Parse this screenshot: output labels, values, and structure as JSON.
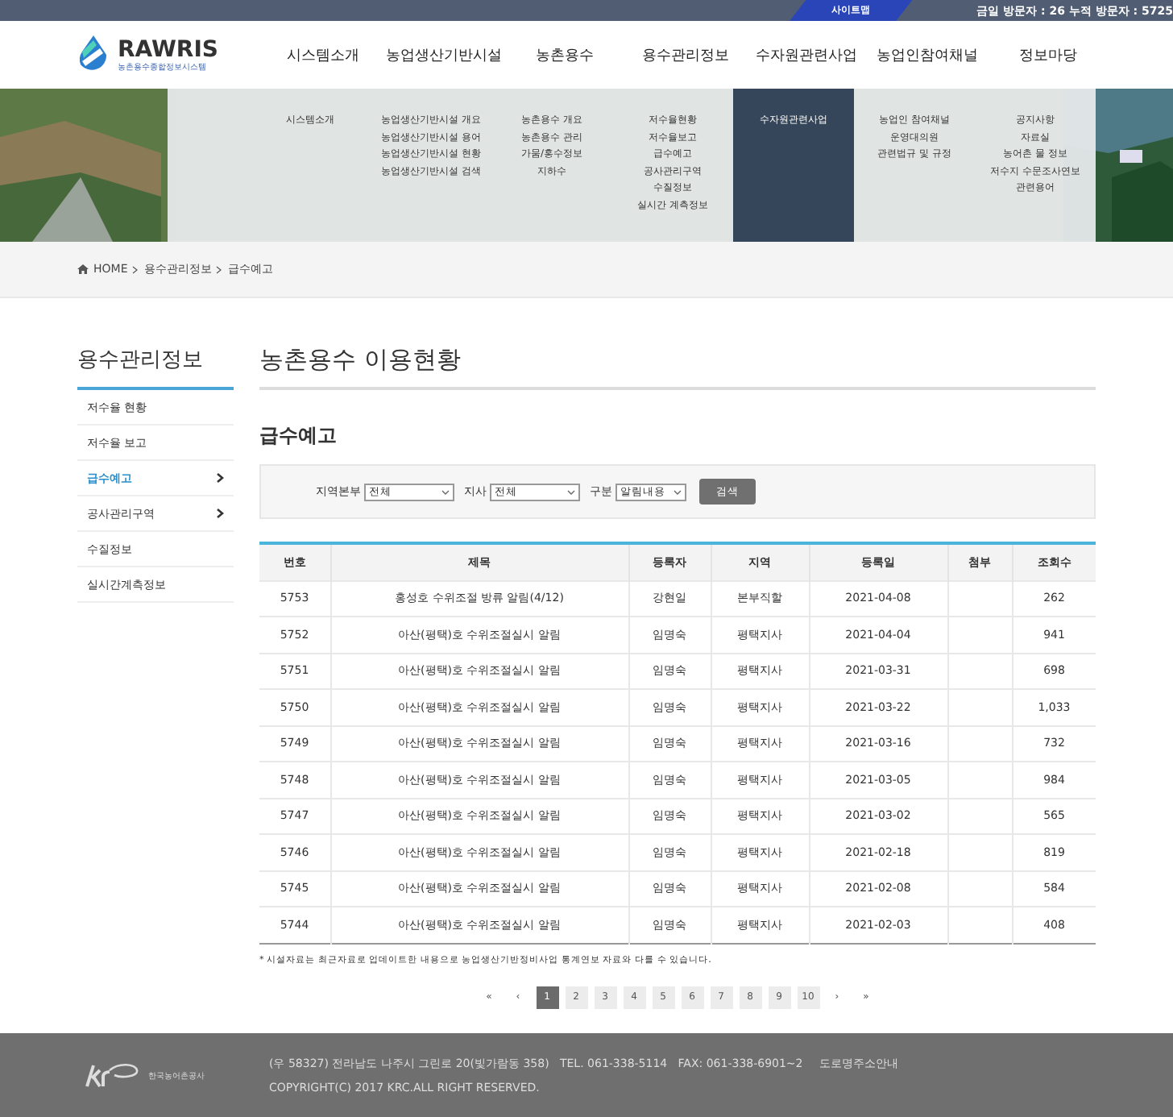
{
  "top_bar": {
    "sitemap": "사이트맵",
    "visitors": "금일 방문자 : 26 누적 방문자 : 5725"
  },
  "logo": {
    "name": "RAWRIS",
    "subtitle": "농촌용수종합정보시스템"
  },
  "nav": [
    {
      "label": "시스템소개",
      "selected": false,
      "children": [
        "시스템소개"
      ]
    },
    {
      "label": "농업생산기반시설",
      "selected": false,
      "children": [
        "농업생산기반시설 개요",
        "농업생산기반시설 용어",
        "농업생산기반시설 현황",
        "농업생산기반시설 검색"
      ]
    },
    {
      "label": "농촌용수",
      "selected": false,
      "children": [
        "농촌용수 개요",
        "농촌용수 관리",
        "가뭄/홍수정보",
        "지하수"
      ]
    },
    {
      "label": "용수관리정보",
      "selected": false,
      "children": [
        "저수율현황",
        "저수율보고",
        "급수예고",
        "공사관리구역",
        "수질정보",
        "실시간 계측정보"
      ]
    },
    {
      "label": "수자원관련사업",
      "selected": true,
      "children": [
        "수자원관련사업"
      ]
    },
    {
      "label": "농업인참여채널",
      "selected": false,
      "children": [
        "농업인 참여채널",
        "운영대의원",
        "관련법규 및 규정"
      ]
    },
    {
      "label": "정보마당",
      "selected": false,
      "children": [
        "공지사항",
        "자료실",
        "농어촌 물 정보",
        "저수지 수문조사연보",
        "관련용어"
      ]
    }
  ],
  "breadcrumb": [
    "HOME",
    "용수관리정보",
    "급수예고"
  ],
  "sidebar": {
    "title": "용수관리정보",
    "items": [
      {
        "label": "저수율 현황",
        "selected": false,
        "arrow": false
      },
      {
        "label": "저수율 보고",
        "selected": false,
        "arrow": false
      },
      {
        "label": "급수예고",
        "selected": true,
        "arrow": true
      },
      {
        "label": "공사관리구역",
        "selected": false,
        "arrow": true
      },
      {
        "label": "수질정보",
        "selected": false,
        "arrow": false
      },
      {
        "label": "실시간계측정보",
        "selected": false,
        "arrow": false
      }
    ]
  },
  "page_title": "농촌용수 이용현황",
  "section_title": "급수예고",
  "filters": [
    {
      "label": "지역본부",
      "value": "전체"
    },
    {
      "label": "지사",
      "value": "전체"
    },
    {
      "label": "구분",
      "value": "알림내용"
    }
  ],
  "search_button": "검색",
  "table": {
    "columns": [
      "번호",
      "제목",
      "등록자",
      "지역",
      "등록일",
      "첨부",
      "조회수"
    ],
    "rows": [
      [
        "5753",
        "홍성호 수위조절 방류 알림(4/12)",
        "강현일",
        "본부직할",
        "2021-04-08",
        "",
        "262"
      ],
      [
        "5752",
        "아산(평택)호 수위조절실시 알림",
        "임명숙",
        "평택지사",
        "2021-04-04",
        "",
        "941"
      ],
      [
        "5751",
        "아산(평택)호 수위조절실시 알림",
        "임명숙",
        "평택지사",
        "2021-03-31",
        "",
        "698"
      ],
      [
        "5750",
        "아산(평택)호 수위조절실시 알림",
        "임명숙",
        "평택지사",
        "2021-03-22",
        "",
        "1,033"
      ],
      [
        "5749",
        "아산(평택)호 수위조절실시 알림",
        "임명숙",
        "평택지사",
        "2021-03-16",
        "",
        "732"
      ],
      [
        "5748",
        "아산(평택)호 수위조절실시 알림",
        "임명숙",
        "평택지사",
        "2021-03-05",
        "",
        "984"
      ],
      [
        "5747",
        "아산(평택)호 수위조절실시 알림",
        "임명숙",
        "평택지사",
        "2021-03-02",
        "",
        "565"
      ],
      [
        "5746",
        "아산(평택)호 수위조절실시 알림",
        "임명숙",
        "평택지사",
        "2021-02-18",
        "",
        "819"
      ],
      [
        "5745",
        "아산(평택)호 수위조절실시 알림",
        "임명숙",
        "평택지사",
        "2021-02-08",
        "",
        "584"
      ],
      [
        "5744",
        "아산(평택)호 수위조절실시 알림",
        "임명숙",
        "평택지사",
        "2021-02-03",
        "",
        "408"
      ]
    ]
  },
  "note": "* 시설자료는 최근자료로 업데이트한 내용으로 농업생산기반정비사업 통계연보 자료와 다를 수 있습니다.",
  "pagination": {
    "first": "«",
    "prev": "‹",
    "pages": [
      {
        "label": "1",
        "selected": true
      },
      {
        "label": "2",
        "selected": false
      },
      {
        "label": "3",
        "selected": false
      },
      {
        "label": "4",
        "selected": false
      },
      {
        "label": "5",
        "selected": false
      },
      {
        "label": "6",
        "selected": false
      },
      {
        "label": "7",
        "selected": false
      },
      {
        "label": "8",
        "selected": false
      },
      {
        "label": "9",
        "selected": false
      },
      {
        "label": "10",
        "selected": false
      }
    ],
    "next": "›",
    "last": "»"
  },
  "footer": {
    "org": "한국농어촌공사",
    "address": "(우 58327) 전라남도 나주시 그린로 20(빛가람동 358)   TEL. 061-338-5114   FAX: 061-338-6901~2",
    "road_link": "도로명주소안내",
    "copyright": "COPYRIGHT(C) 2017 KRC.ALL RIGHT RESERVED."
  }
}
